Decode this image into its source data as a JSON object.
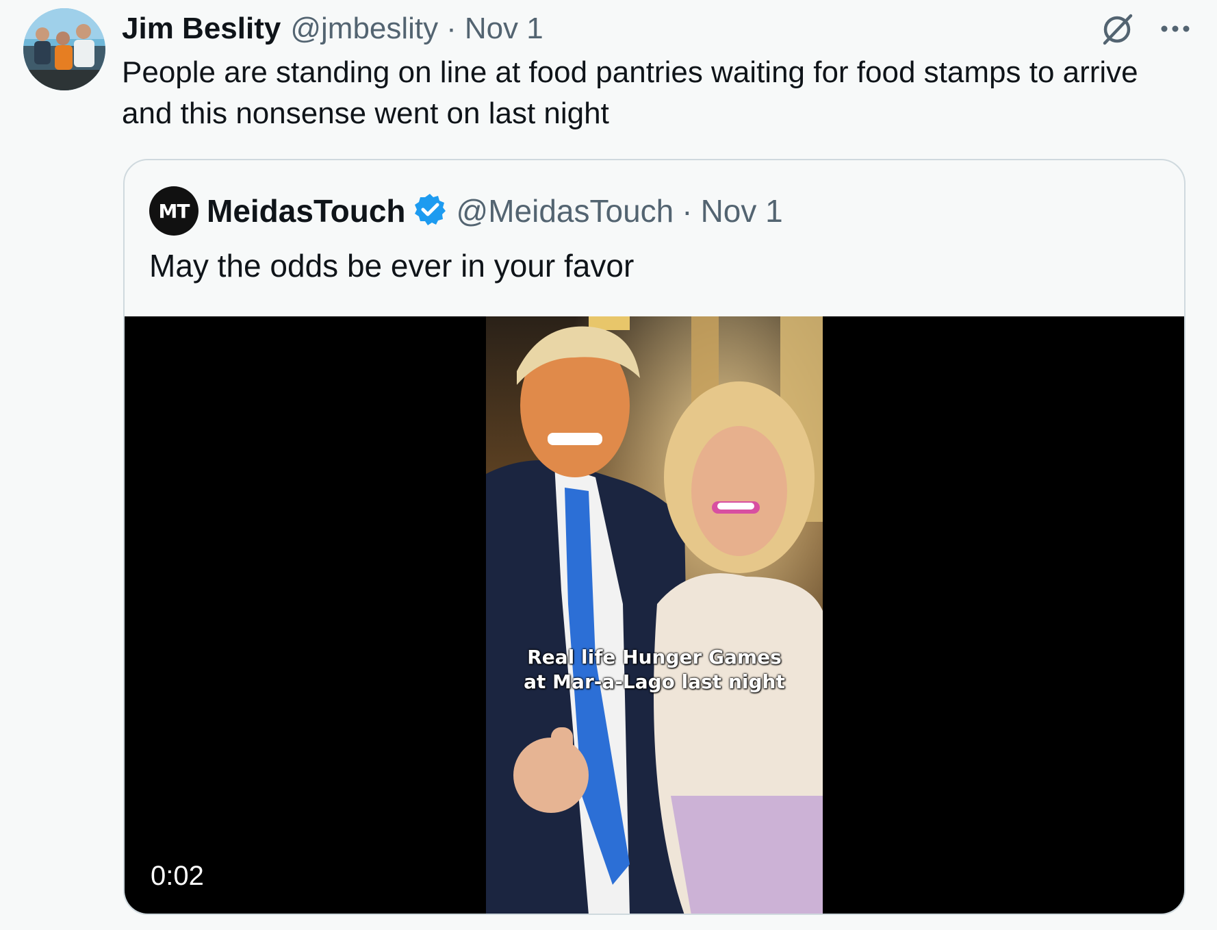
{
  "post": {
    "author_name": "Jim Beslity",
    "author_handle": "@jmbeslity",
    "separator": "·",
    "date": "Nov 1",
    "text": "People are standing on line at food pantries waiting for food stamps to arrive and this nonsense went on last night"
  },
  "quoted": {
    "logo_text": "MT",
    "author_name": "MeidasTouch",
    "verified": true,
    "author_handle": "@MeidasTouch",
    "separator": "·",
    "date": "Nov 1",
    "text": "May the odds be ever in your favor",
    "video": {
      "caption_line1": "Real life Hunger Games",
      "caption_line2": "at Mar-a-Lago last night",
      "duration": "0:02"
    }
  },
  "icons": {
    "grok": "grok-icon",
    "more": "more-icon",
    "verified": "verified-badge-icon"
  },
  "colors": {
    "background": "#f7f9f9",
    "secondary_text": "#536471",
    "border": "#cfd9de",
    "verified_blue": "#1d9bf0"
  }
}
